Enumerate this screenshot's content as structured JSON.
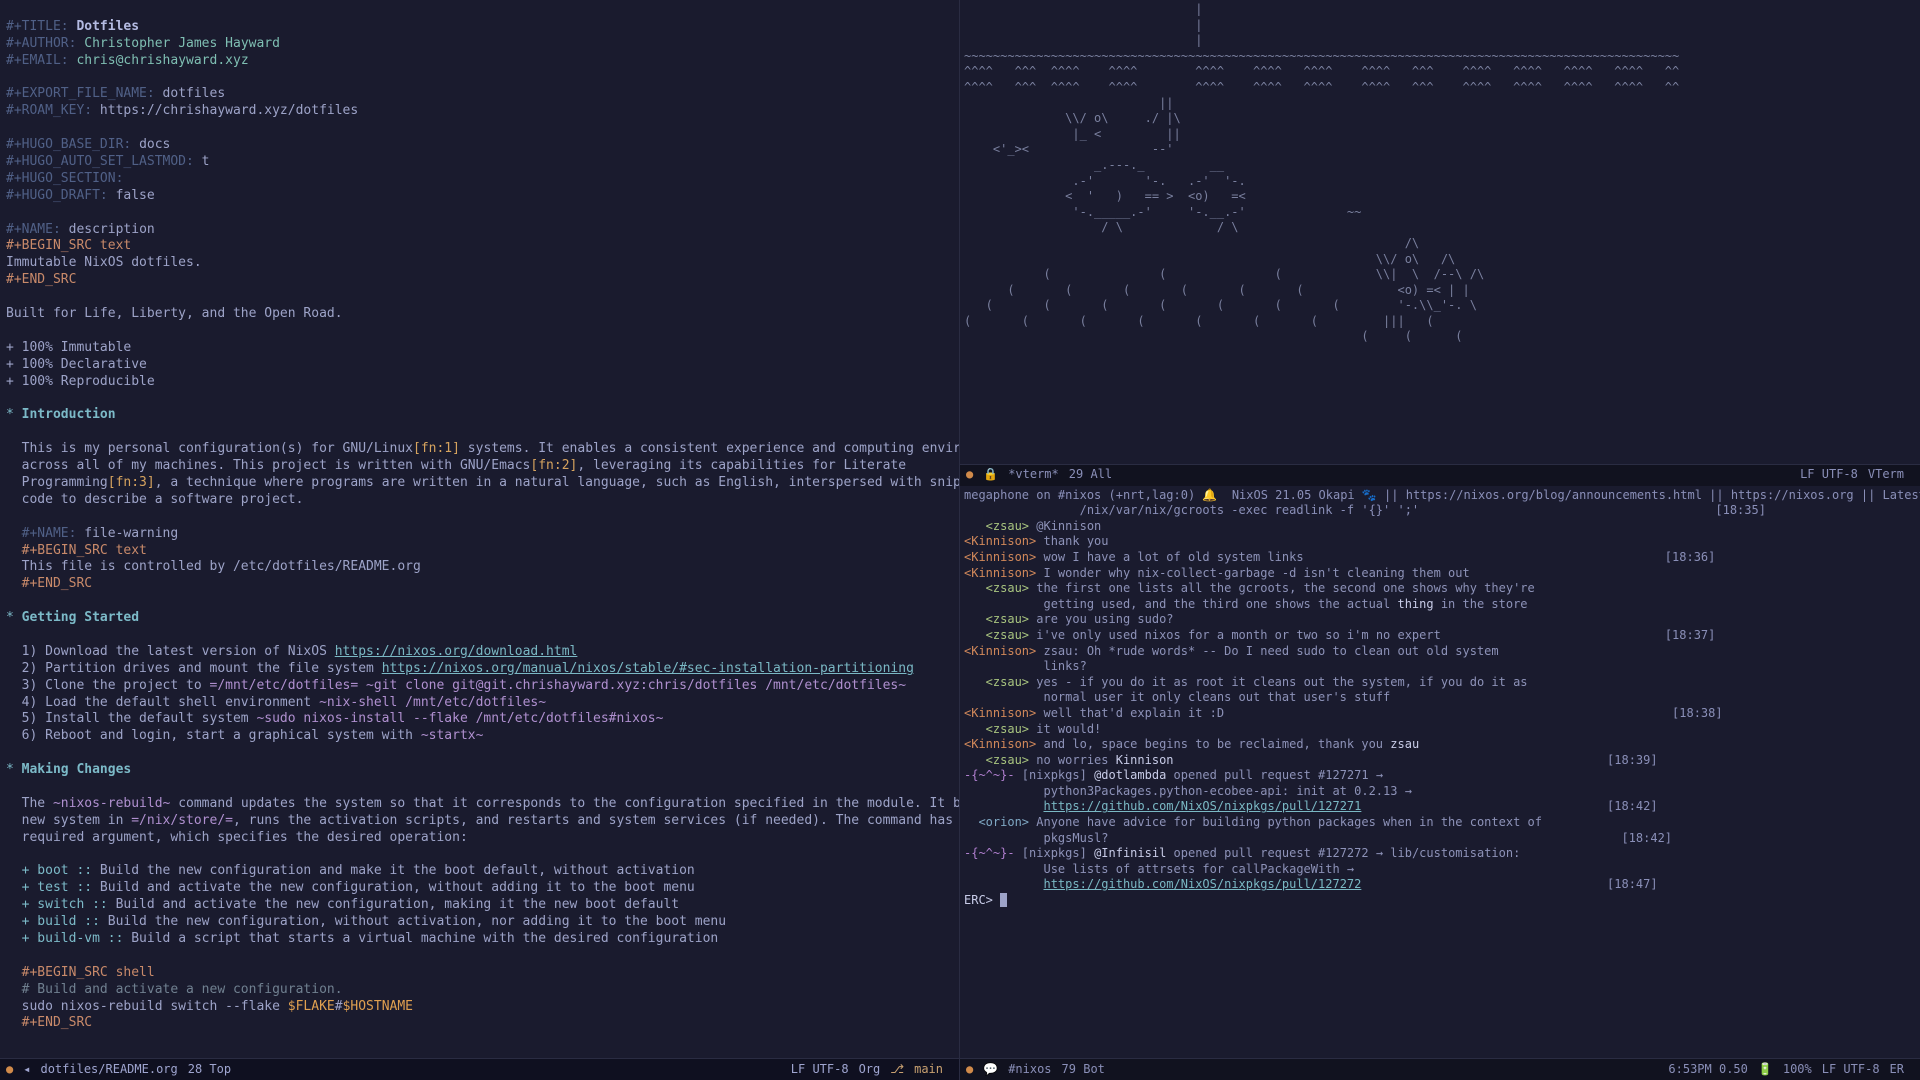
{
  "org": {
    "title_kw": "#+TITLE:",
    "title": "Dotfiles",
    "author_kw": "#+AUTHOR:",
    "author": "Christopher James Hayward",
    "email_kw": "#+EMAIL:",
    "email": "chris@chrishayward.xyz",
    "export_kw": "#+EXPORT_FILE_NAME:",
    "export": "dotfiles",
    "roam_kw": "#+ROAM_KEY:",
    "roam": "https://chrishayward.xyz/dotfiles",
    "hugo_base_kw": "#+HUGO_BASE_DIR:",
    "hugo_base": "docs",
    "hugo_lastmod_kw": "#+HUGO_AUTO_SET_LASTMOD:",
    "hugo_lastmod": "t",
    "hugo_section_kw": "#+HUGO_SECTION:",
    "hugo_draft_kw": "#+HUGO_DRAFT:",
    "hugo_draft": "false",
    "name_desc_kw": "#+NAME:",
    "name_desc": "description",
    "begin_src_text": "#+BEGIN_SRC text",
    "desc_body": "Immutable NixOS dotfiles.",
    "end_src": "#+END_SRC",
    "tagline": "Built for Life, Liberty, and the Open Road.",
    "feat1": "+ 100% Immutable",
    "feat2": "+ 100% Declarative",
    "feat3": "+ 100% Reproducible",
    "h_intro_star": "*",
    "h_intro": "Introduction",
    "intro_text1": "  This is my personal configuration(s) for GNU/Linux",
    "fn1": "[fn:1]",
    "intro_text1b": " systems. It enables a consistent experience and computing environment",
    "intro_text2": "  across all of my machines. This project is written with GNU/Emacs",
    "fn2": "[fn:2]",
    "intro_text2b": ", leveraging its capabilities for Literate",
    "intro_text3": "  Programming",
    "fn3": "[fn:3]",
    "intro_text3b": ", a technique where programs are written in a natural language, such as English, interspersed with snippets of",
    "intro_text4": "  code to describe a software project.",
    "name_warn_kw": "  #+NAME:",
    "name_warn": "file-warning",
    "begin_src_text2": "  #+BEGIN_SRC text",
    "warn_body": "  This file is controlled by /etc/dotfiles/README.org",
    "end_src2": "  #+END_SRC",
    "h_getting_star": "*",
    "h_getting": "Getting Started",
    "gs1a": "  1) Download the latest version of NixOS ",
    "gs1_link": "https://nixos.org/download.html",
    "gs2a": "  2) Partition drives and mount the file system ",
    "gs2_link": "https://nixos.org/manual/nixos/stable/#sec-installation-partitioning",
    "gs3a": "  3) Clone the project to ",
    "gs3_path": "=/mnt/etc/dotfiles=",
    "gs3_cmd": " ~git clone git@git.chrishayward.xyz:chris/dotfiles /mnt/etc/dotfiles~",
    "gs4a": "  4) Load the default shell environment ",
    "gs4_cmd": "~nix-shell /mnt/etc/dotfiles~",
    "gs5a": "  5) Install the default system ",
    "gs5_cmd": "~sudo nixos-install --flake /mnt/etc/dotfiles#nixos~",
    "gs6a": "  6) Reboot and login, start a graphical system with ",
    "gs6_cmd": "~startx~",
    "h_making_star": "*",
    "h_making": "Making Changes",
    "mc1": "  The ",
    "mc1_cmd": "~nixos-rebuild~",
    "mc1b": " command updates the system so that it corresponds to the configuration specified in the module. It builds the",
    "mc2": "  new system in ",
    "mc2_path": "=/nix/store/=",
    "mc2b": ", runs the activation scripts, and restarts and system services (if needed). The command has one",
    "mc3": "  required argument, which specifies the desired operation:",
    "op_boot_k": "  + boot ::",
    "op_boot": " Build the new configuration and make it the boot default, without activation",
    "op_test_k": "  + test ::",
    "op_test": " Build and activate the new configuration, without adding it to the boot menu",
    "op_switch_k": "  + switch ::",
    "op_switch": " Build and activate the new configuration, making it the new boot default",
    "op_build_k": "  + build ::",
    "op_build": " Build the new configuration, without activation, nor adding it to the boot menu",
    "op_vm_k": "  + build-vm ::",
    "op_vm": " Build a script that starts a virtual machine with the desired configuration",
    "begin_src_sh": "  #+BEGIN_SRC shell",
    "sh_comment": "  # Build and activate a new configuration.",
    "sh_cmd1": "  sudo nixos-rebuild switch --flake ",
    "sh_var1": "$FLAKE",
    "sh_lit": "#",
    "sh_var2": "$HOSTNAME",
    "end_src3": "  #+END_SRC"
  },
  "left_modeline": {
    "file": "dotfiles/README.org",
    "pos": "28 Top",
    "enc": "LF UTF-8",
    "mode": "Org",
    "branch_icon": "⎇",
    "branch": "main"
  },
  "vterm_modeline": {
    "name": "*vterm*",
    "pos": "29 All",
    "enc": "LF UTF-8",
    "mode": "VTerm"
  },
  "erc": {
    "topic1": "megaphone on #nixos (+nrt,lag:0) ",
    "topic2": " NixOS 21.05 Okapi ",
    "topic3": " || https://nixos.org/blog/announcements.html || https://nixos.org || Latest NixO",
    "topic4": "                /nix/var/nix/gcroots -exec readlink -f '{}' ';'",
    "ts1": "[18:35]",
    "l1_n": "   <zsau>",
    "l1_t": " @Kinnison",
    "l2_n": "<Kinnison>",
    "l2_t": " thank you",
    "l3_n": "<Kinnison>",
    "l3_t": " wow I have a lot of old system links",
    "ts2": "[18:36]",
    "l4_n": "<Kinnison>",
    "l4_t": " I wonder why nix-collect-garbage -d isn't cleaning them out",
    "l5_n": "   <zsau>",
    "l5_t": " the first one lists all the gcroots, the second one shows why they're",
    "l5b": "           getting used, and the third one shows the actual ",
    "l5c": "thing",
    "l5d": " in the store",
    "l6_n": "   <zsau>",
    "l6_t": " are you using sudo?",
    "l7_n": "   <zsau>",
    "l7_t": " i've only used nixos for a month or two so i'm no expert",
    "ts3": "[18:37]",
    "l8_n": "<Kinnison>",
    "l8_t": " zsau: Oh *rude words* -- Do I need sudo to clean out old system",
    "l8b": "           links?",
    "l9_n": "   <zsau>",
    "l9_t": " yes - if you do it as root it cleans out the system, if you do it as",
    "l9b": "           normal user it only cleans out that user's stuff",
    "l10_n": "<Kinnison>",
    "l10_t": " well that'd explain it :D",
    "ts4": "[18:38]",
    "l11_n": "   <zsau>",
    "l11_t": " it would!",
    "l12_n": "<Kinnison>",
    "l12_t": " and lo, space begins to be reclaimed, thank you ",
    "l12b": "zsau",
    "l13_n": "   <zsau>",
    "l13_t": " no worries ",
    "l13b": "Kinnison",
    "ts5": "[18:39]",
    "l14_n": "-{~^~}-",
    "l14_t": " [nixpkgs] ",
    "l14_u": "@dotlambda",
    "l14_b": " opened pull request #127271 →",
    "l14c": "           python3Packages.python-ecobee-api: init at 0.2.13 →",
    "l14_url": "https://github.com/NixOS/nixpkgs/pull/127271",
    "l15_n": "  <orion>",
    "l15_t": " Anyone have advice for building python packages when in the context of",
    "l15b": "           pkgsMusl?",
    "ts6": "[18:42]",
    "l16_n": "-{~^~}-",
    "l16_t": " [nixpkgs] ",
    "l16_u": "@Infinisil",
    "l16_b": " opened pull request #127272 → lib/customisation:",
    "l16c": "           Use lists of attrsets for callPackageWith →",
    "l16_url": "https://github.com/NixOS/nixpkgs/pull/127272",
    "ts7": "[18:47]",
    "prompt": "ERC> "
  },
  "erc_modeline": {
    "chan": "#nixos",
    "pos": "79 Bot",
    "time": "6:53PM 0.50",
    "batt": "100%",
    "enc": "LF UTF-8",
    "mode": "ER"
  },
  "ascii_art": "                                |\n                                |\n                                |\n~~~~~~~~~~~~~~~~~~~~~~~~~~~~~~~~~~~~~~~~~~~~~~~~~~~~~~~~~~~~~~~~~~~~~~~~~~~~~~~~~~~~~~~~~~~~~~~~~~~\n^^^^   ^^^  ^^^^    ^^^^        ^^^^    ^^^^   ^^^^    ^^^^   ^^^    ^^^^   ^^^^   ^^^^   ^^^^   ^^\n^^^^   ^^^  ^^^^    ^^^^        ^^^^    ^^^^   ^^^^    ^^^^   ^^^    ^^^^   ^^^^   ^^^^   ^^^^   ^^\n                           ||\n              \\\\/ o\\     ./ |\\\n               |_ <         ||\n    <'_><                 --'\n                  _.---._         __\n               .-'       '-.   .-'  '-.\n              <  '   )   == >  <o)   =<\n               '-._____.-'     '-.__.-'              ~~\n                   / \\             / \\\n                                                             /\\\n                                                         \\\\/ o\\   /\\\n           (               (               (             \\\\|  \\  /--\\ /\\\n      (       (       (       (       (       (             <o) =< | |\n   (       (       (       (       (       (       (        '-.\\\\_'-. \\\n(       (       (       (       (       (       (         |||   (\n                                                       (     (      ("
}
